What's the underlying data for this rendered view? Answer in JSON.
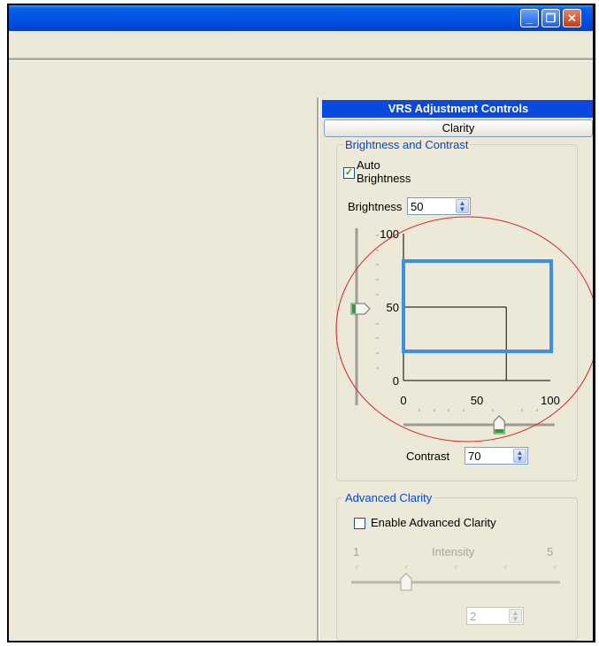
{
  "window": {
    "minimize_icon": "minimize-icon",
    "maximize_icon": "restore-icon",
    "close_icon": "close-icon"
  },
  "panel": {
    "title": "VRS Adjustment Controls",
    "clarity_button": "Clarity",
    "brightness_contrast": {
      "group_title": "Brightness and Contrast",
      "auto_brightness_line1": "Auto",
      "auto_brightness_line2": "Brightness",
      "auto_brightness_checked": true,
      "brightness_label": "Brightness",
      "brightness_value": "50",
      "contrast_label": "Contrast",
      "contrast_value": "70",
      "graph": {
        "y_ticks": [
          "100",
          "50",
          "0"
        ],
        "x_ticks": [
          "0",
          "50",
          "100"
        ],
        "brightness": 50,
        "contrast": 70
      }
    },
    "advanced_clarity": {
      "group_title": "Advanced Clarity",
      "enable_label": "Enable Advanced Clarity",
      "enable_checked": false,
      "min_label": "1",
      "intensity_label": "Intensity",
      "max_label": "5",
      "intensity_value": "2"
    }
  },
  "colors": {
    "header_blue": "#0a48e0",
    "highlight_box": "#3b8fe8",
    "annotation_circle": "#dd2222"
  }
}
